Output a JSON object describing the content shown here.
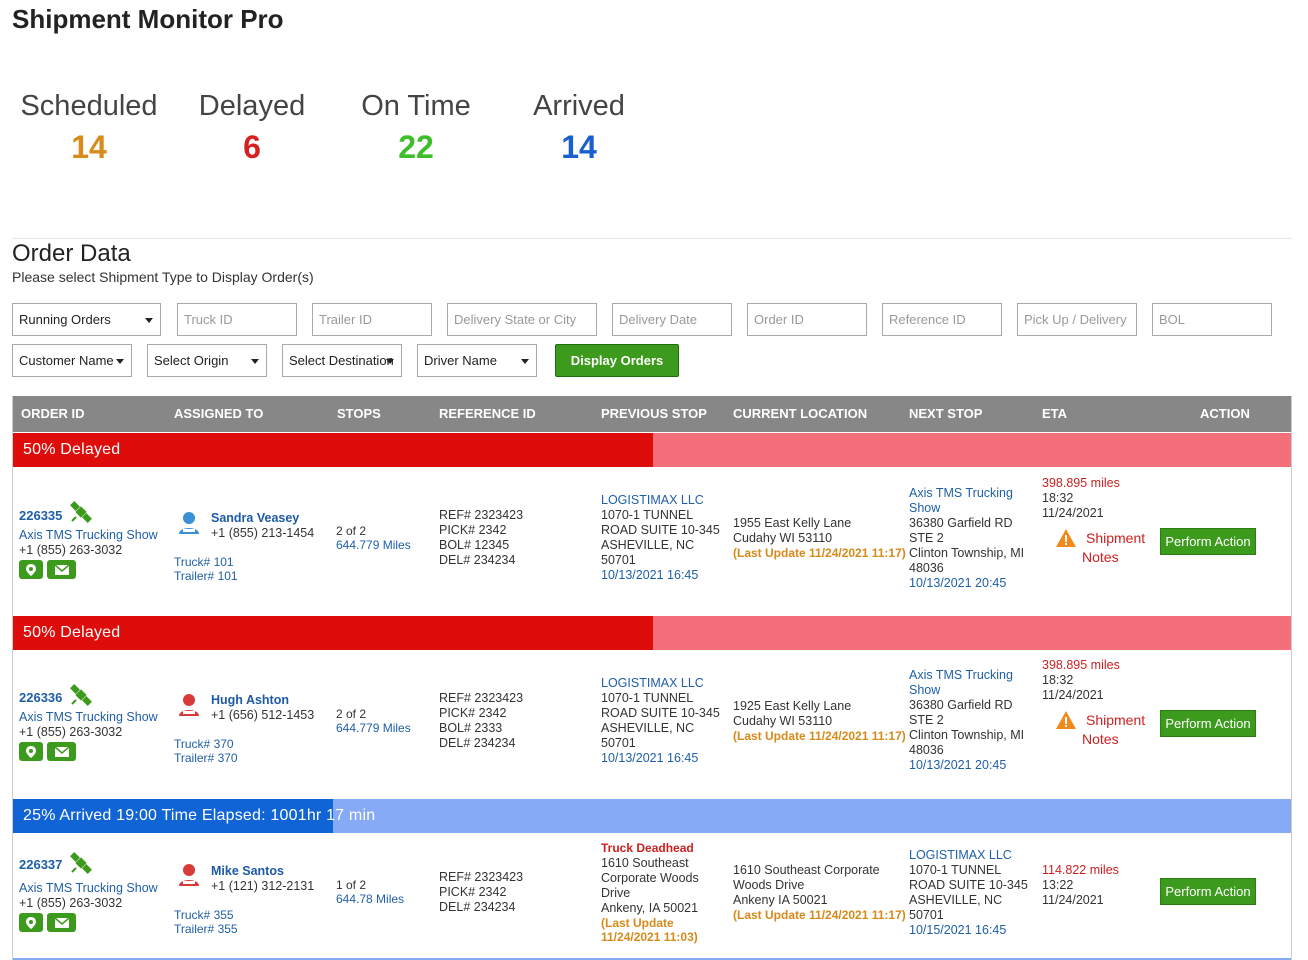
{
  "app": {
    "title": "Shipment Monitor Pro"
  },
  "stats": [
    {
      "label": "Scheduled",
      "value": "14",
      "color": "#d88a1c"
    },
    {
      "label": "Delayed",
      "value": "6",
      "color": "#d81f1f"
    },
    {
      "label": "On Time",
      "value": "22",
      "color": "#3cbf28"
    },
    {
      "label": "Arrived",
      "value": "14",
      "color": "#1a5fcf"
    }
  ],
  "section": {
    "title": "Order Data",
    "subtitle": "Please select Shipment Type to Display Order(s)"
  },
  "filters": {
    "running_orders": "Running Orders",
    "truck_id": "Truck ID",
    "trailer_id": "Trailer ID",
    "delivery_state": "Delivery State or City",
    "delivery_date": "Delivery Date",
    "order_id": "Order ID",
    "reference_id": "Reference ID",
    "pickup_delivery": "Pick Up / Delivery",
    "bol": "BOL",
    "customer_name": "Customer Name",
    "select_origin": "Select Origin",
    "select_destination": "Select Destination",
    "driver_name": "Driver Name",
    "display_orders": "Display Orders"
  },
  "table": {
    "headers": [
      "ORDER ID",
      "ASSIGNED TO",
      "STOPS",
      "REFERENCE ID",
      "PREVIOUS STOP",
      "CURRENT LOCATION",
      "NEXT STOP",
      "ETA",
      "ACTION"
    ],
    "groups": [
      {
        "status": "50% Delayed",
        "progress": 0.5,
        "fill_color": "#df0c0c",
        "track_color": "#f46f7a",
        "order": {
          "id": "226335",
          "customer": "Axis TMS Trucking Show",
          "customer_phone": "+1 (855) 263-3032",
          "driver": "Sandra Veasey",
          "driver_phone": "+1 (855) 213-1454",
          "avatar_color": "#3a8fd6",
          "truck": "Truck# 101",
          "trailer": "Trailer# 101",
          "stops": "2 of 2",
          "miles": "644.779 Miles",
          "refs": [
            "REF# 2323423",
            "PICK# 2342",
            "BOL# 12345",
            "DEL# 234234"
          ],
          "prev_name": "LOGISTIMAX LLC",
          "prev_lines": [
            "1070-1 TUNNEL",
            "ROAD SUITE 10-345",
            "ASHEVILLE, NC",
            "50701"
          ],
          "prev_time": "10/13/2021 16:45",
          "cur_lines": [
            "1955 East Kelly Lane",
            "Cudahy WI 53110"
          ],
          "cur_update": "(Last Update 11/24/2021 11:17)",
          "next_name": [
            "Axis TMS Trucking",
            "Show"
          ],
          "next_lines": [
            "36380 Garfield RD",
            "STE 2",
            "Clinton Township, MI",
            "48036"
          ],
          "next_time": "10/13/2021 20:45",
          "eta_miles": "398.895 miles",
          "eta_time": "18:32",
          "eta_date": "11/24/2021",
          "notes": [
            "Shipment",
            "Notes"
          ],
          "action": "Perform Action"
        }
      },
      {
        "status": "50% Delayed",
        "progress": 0.5,
        "fill_color": "#df0c0c",
        "track_color": "#f46f7a",
        "order": {
          "id": "226336",
          "customer": "Axis TMS Trucking Show",
          "customer_phone": "+1 (855) 263-3032",
          "driver": "Hugh Ashton",
          "driver_phone": "+1 (656) 512-1453",
          "avatar_color": "#d83a3a",
          "truck": "Truck# 370",
          "trailer": "Trailer# 370",
          "stops": "2 of 2",
          "miles": "644.779 Miles",
          "refs": [
            "REF# 2323423",
            "PICK# 2342",
            "BOL# 2333",
            "DEL# 234234"
          ],
          "prev_name": "LOGISTIMAX LLC",
          "prev_lines": [
            "1070-1 TUNNEL",
            "ROAD SUITE 10-345",
            "ASHEVILLE, NC",
            "50701"
          ],
          "prev_time": "10/13/2021 16:45",
          "cur_lines": [
            "1925 East Kelly Lane",
            "Cudahy WI 53110"
          ],
          "cur_update": "(Last Update 11/24/2021 11:17)",
          "next_name": [
            "Axis TMS Trucking",
            "Show"
          ],
          "next_lines": [
            "36380 Garfield RD",
            "STE 2",
            "Clinton Township, MI",
            "48036"
          ],
          "next_time": "10/13/2021 20:45",
          "eta_miles": "398.895 miles",
          "eta_time": "18:32",
          "eta_date": "11/24/2021",
          "notes": [
            "Shipment",
            "Notes"
          ],
          "action": "Perform Action"
        }
      },
      {
        "status": "25% Arrived 19:00 Time Elapsed: 1001hr 17 min",
        "progress": 0.25,
        "fill_color": "#1064d6",
        "track_color": "#86aaf5",
        "order": {
          "id": "226337",
          "customer": "Axis TMS Trucking Show",
          "customer_phone": "+1 (855) 263-3032",
          "driver": "Mike Santos",
          "driver_phone": "+1 (121) 312-2131",
          "avatar_color": "#d83a3a",
          "truck": "Truck# 355",
          "trailer": "Trailer# 355",
          "stops": "1 of 2",
          "miles": "644.78 Miles",
          "refs": [
            "REF# 2323423",
            "PICK# 2342",
            "DEL# 234234"
          ],
          "prev_title": "Truck Deadhead",
          "prev_lines": [
            "1610 Southeast",
            "Corporate Woods",
            "Drive",
            "Ankeny, IA 50021"
          ],
          "prev_update": [
            "(Last Update",
            "11/24/2021 11:03)"
          ],
          "cur_lines": [
            "1610 Southeast Corporate",
            "Woods Drive",
            "Ankeny IA 50021"
          ],
          "cur_update": "(Last Update 11/24/2021 11:17)",
          "next_name": [
            "LOGISTIMAX LLC"
          ],
          "next_lines": [
            "1070-1 TUNNEL",
            "ROAD SUITE 10-345",
            "ASHEVILLE, NC",
            "50701"
          ],
          "next_time": "10/15/2021 16:45",
          "eta_miles": "114.822 miles",
          "eta_time": "13:22",
          "eta_date": "11/24/2021",
          "action": "Perform Action"
        }
      }
    ]
  }
}
